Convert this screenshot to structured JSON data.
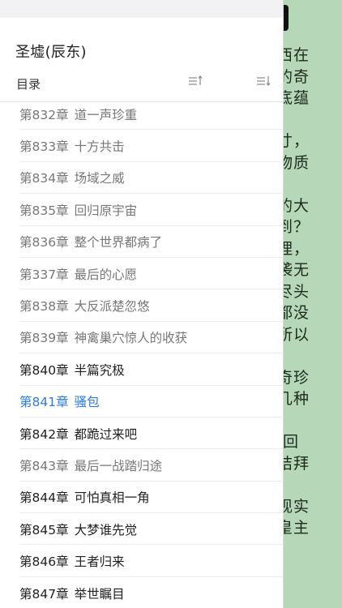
{
  "reader": {
    "background_color": "#b7d8b8",
    "visible_text": "西在\n的奇\n底蕴\n\n寸，\n物质\n\n的大\n到？\n理，\n袭无\n尽头\n都没\n所以\n\n奇珍\n几种\n\n 回\n拮拜\n\n现实\n皇主"
  },
  "drawer": {
    "book_title": "圣墟(辰东)",
    "toc_label": "目录",
    "sort_ascending_icon": "sort-ascending-icon",
    "sort_descending_icon": "sort-descending-icon",
    "colors": {
      "read": "#777777",
      "unread": "#1f1f1f",
      "current": "#2e7dd1"
    },
    "chapters": [
      {
        "num": "第832章",
        "title": "道一声珍重",
        "status": "read"
      },
      {
        "num": "第833章",
        "title": "十方共击",
        "status": "read"
      },
      {
        "num": "第834章",
        "title": "场域之威",
        "status": "read"
      },
      {
        "num": "第835章",
        "title": "回归原宇宙",
        "status": "read"
      },
      {
        "num": "第836章",
        "title": "整个世界都病了",
        "status": "read"
      },
      {
        "num": "第337章",
        "title": "最后的心愿",
        "status": "read"
      },
      {
        "num": "第838章",
        "title": "大反派楚忽悠",
        "status": "read"
      },
      {
        "num": "第839章",
        "title": "神禽巢穴惊人的收获",
        "status": "read"
      },
      {
        "num": "第840章",
        "title": "半篇究极",
        "status": "unread"
      },
      {
        "num": "第841章",
        "title": "骚包",
        "status": "current"
      },
      {
        "num": "第842章",
        "title": "都跪过来吧",
        "status": "unread"
      },
      {
        "num": "第843章",
        "title": "最后一战踏归途",
        "status": "read"
      },
      {
        "num": "第844章",
        "title": "可怕真相一角",
        "status": "unread"
      },
      {
        "num": "第845章",
        "title": "大梦谁先觉",
        "status": "unread"
      },
      {
        "num": "第846章",
        "title": "王者归来",
        "status": "unread"
      },
      {
        "num": "第847章",
        "title": "举世瞩目",
        "status": "unread"
      }
    ]
  }
}
